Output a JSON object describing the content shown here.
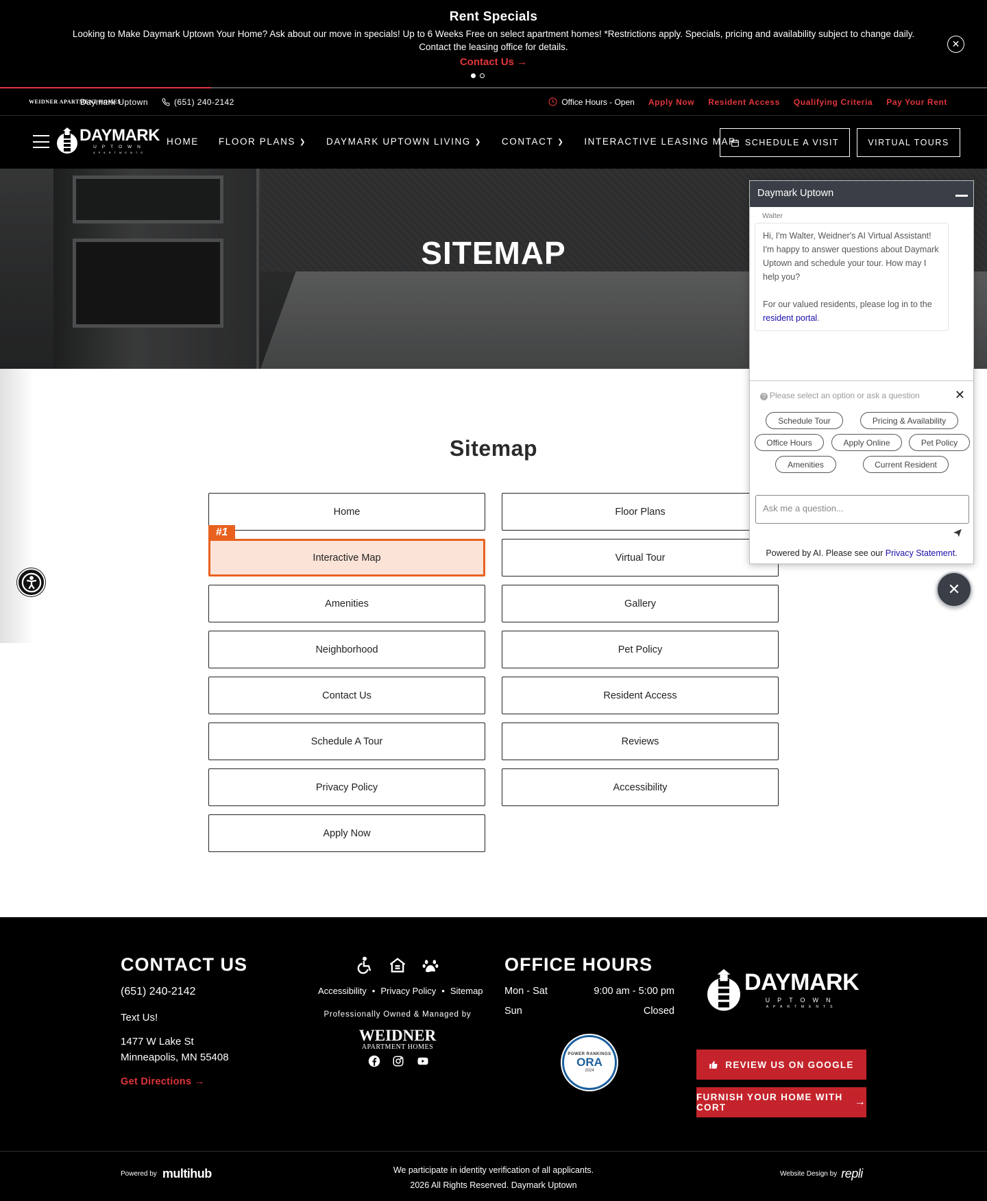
{
  "announcement": {
    "title": "Rent Specials",
    "body": "Looking to Make Daymark Uptown Your Home? Ask about our move in specials! Up to 6 Weeks Free on select apartment homes! *Restrictions apply. Specials, pricing and availability subject to change daily. Contact the leasing office for details.",
    "cta": "Contact Us →"
  },
  "utility": {
    "brand_logo": "WEIDNER APARTMENT HOMES",
    "property": "Daymark Uptown",
    "phone": "(651) 240-2142",
    "office_hours": "Office Hours - Open",
    "links": [
      "Apply Now",
      "Resident Access",
      "Qualifying Criteria",
      "Pay Your Rent"
    ],
    "accent": "#e0353b"
  },
  "nav": {
    "logo_big": "DAYMARK",
    "logo_small": "UPTOWN",
    "logo_tiny": "APARTMENTS",
    "items": [
      "HOME",
      "FLOOR PLANS",
      "DAYMARK UPTOWN LIVING",
      "CONTACT",
      "INTERACTIVE LEASING MAP"
    ],
    "schedule": "SCHEDULE A VISIT",
    "tours": "VIRTUAL TOURS"
  },
  "hero": {
    "title": "SITEMAP"
  },
  "sitemap": {
    "title": "Sitemap",
    "badge": "#1",
    "left": [
      "Home",
      "Interactive Map",
      "Amenities",
      "Neighborhood",
      "Contact Us",
      "Schedule A Tour",
      "Privacy Policy",
      "Apply Now"
    ],
    "right": [
      "Floor Plans",
      "Virtual Tour",
      "Gallery",
      "Pet Policy",
      "Resident Access",
      "Reviews",
      "Accessibility"
    ],
    "highlight_color": "#e8611e"
  },
  "chat": {
    "header": "Daymark Uptown",
    "agent": "Walter",
    "message": "Hi, I'm Walter, Weidner's AI Virtual Assistant! I'm happy to answer questions about Daymark Uptown and schedule your tour. How may I help you?",
    "message2_pre": "For our valued residents, please log in to the ",
    "message2_link": "resident portal",
    "message2_post": ".",
    "hint": "Please select an option or ask a question",
    "options": [
      "Schedule Tour",
      "Pricing & Availability",
      "Office Hours",
      "Apply Online",
      "Pet Policy",
      "Amenities",
      "Current Resident"
    ],
    "input_placeholder": "Ask me a question...",
    "footer_pre": "Powered by AI. Please see our ",
    "footer_link": "Privacy Statement",
    "footer_post": "."
  },
  "footer": {
    "contact_title": "CONTACT US",
    "phone": "(651) 240-2142",
    "text": "Text Us!",
    "address1": "1477 W Lake St",
    "address2": "Minneapolis, MN 55408",
    "directions": "Get Directions →",
    "links": [
      "Accessibility",
      "Privacy Policy",
      "Sitemap"
    ],
    "managed": "Professionally Owned & Managed by",
    "weidner1": "WEIDNER",
    "weidner2": "APARTMENT HOMES",
    "hours_title": "OFFICE HOURS",
    "hours": [
      {
        "day": "Mon - Sat",
        "time": "9:00 am - 5:00 pm"
      },
      {
        "day": "Sun",
        "time": "Closed"
      }
    ],
    "ora_top": "POWER RANKINGS",
    "ora_mid": "ORA",
    "ora_year": "2024",
    "logo_big": "DAYMARK",
    "logo_small": "UPTOWN",
    "logo_tiny": "APARTMENTS",
    "review_btn": "REVIEW US ON GOOGLE",
    "cort_btn": "FURNISH YOUR HOME WITH CORT",
    "powered_by": "Powered by",
    "powered_brand": "multihub",
    "identity": "We participate in identity verification of all applicants.",
    "copyright": "2026 All Rights Reserved. Daymark Uptown",
    "design_by": "Website Design by",
    "design_brand": "repli"
  }
}
